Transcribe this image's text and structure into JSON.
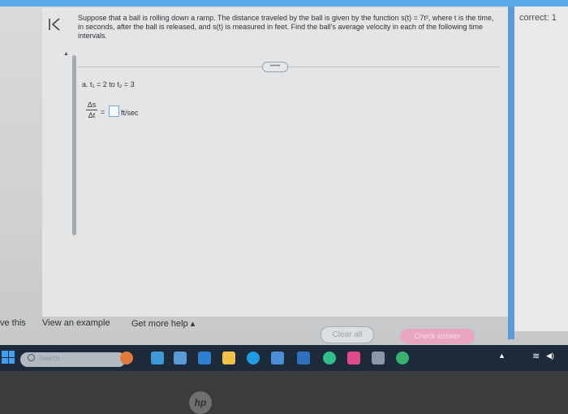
{
  "status": {
    "correct_label": "correct: 1"
  },
  "question": {
    "text": "Suppose that a ball is rolling down a ramp. The distance traveled by the ball is given by the function s(t) = 7t², where t is the time, in seconds, after the ball is released, and s(t) is measured in feet. Find the ball's average velocity in each of the following time intervals."
  },
  "part_a": {
    "label": "a. t₁ = 2 to t₂ = 3",
    "frac_num": "Δs",
    "frac_den": "Δt",
    "equals": "=",
    "answer_value": "",
    "unit": "ft/sec"
  },
  "more_pill": "•••••",
  "bottom_bar": {
    "solve_this": "ve this",
    "view_example": "View an example",
    "get_help": "Get more help ▴",
    "clear_all": "Clear all",
    "check_answer": "Check answer"
  },
  "taskbar": {
    "search_placeholder": "Search"
  },
  "bezel": {
    "logo": "hp"
  },
  "colors": {
    "accent_blue": "#5b9bd8",
    "check_answer_bg": "#e9a6c2",
    "taskbar_bg": "#1d2a3a"
  }
}
